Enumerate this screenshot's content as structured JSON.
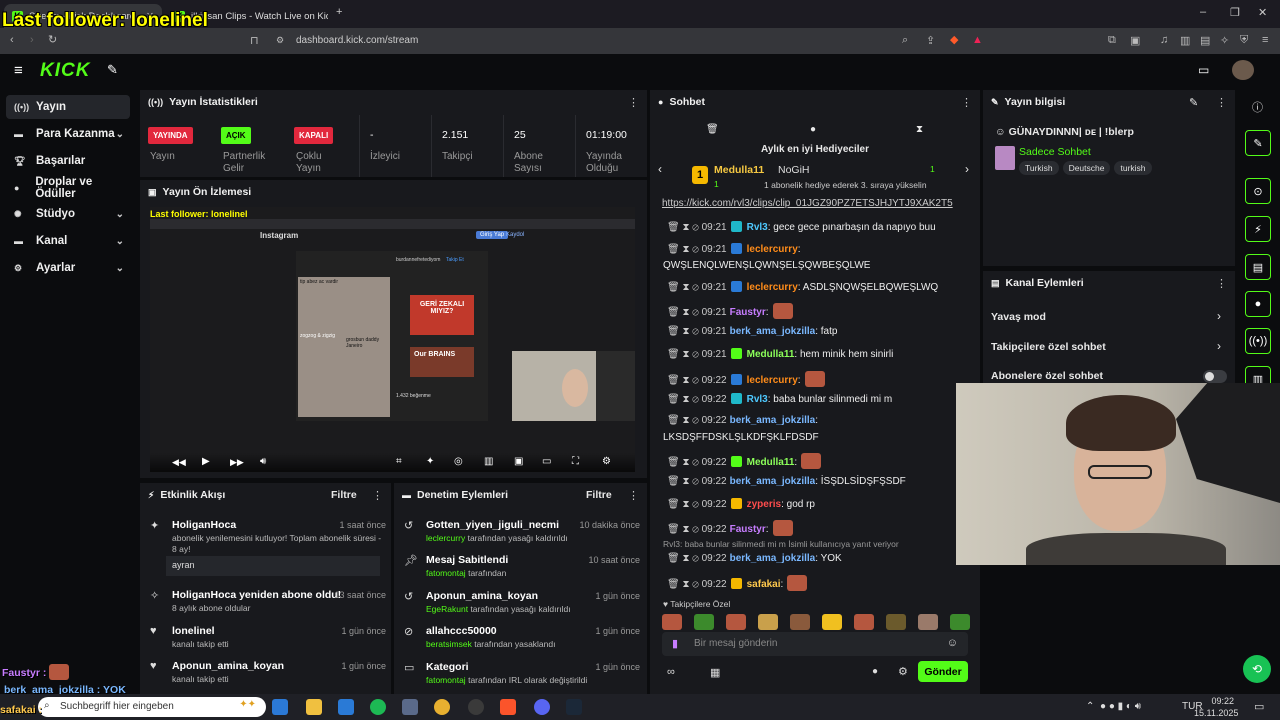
{
  "overlay": {
    "last_follower": "Last follower: lonelinel",
    "bottom_lines": [
      "Faustyr :",
      "berk_ama_jokzilla : YOK",
      "safakai :"
    ]
  },
  "browser": {
    "tabs": [
      "Stream - Kick Dashboard",
      "ilkinsan Clips - Watch Live on Kick"
    ],
    "url": "dashboard.kick.com/stream"
  },
  "sidebar": {
    "items": [
      "Yayın",
      "Para Kazanma",
      "Başarılar",
      "Droplar ve Ödüller",
      "Stüdyo",
      "Kanal",
      "Ayarlar"
    ]
  },
  "stats": {
    "title": "Yayın İstatistikleri",
    "badges": [
      "YAYINDA",
      "AÇIK",
      "KAPALI"
    ],
    "labels": [
      "Yayın",
      "Partnerlik Gelir",
      "Çoklu Yayın",
      "İzleyici",
      "Takipçi",
      "Abone Sayısı",
      "Yayında Olduğu"
    ],
    "values": [
      "-",
      "2.151",
      "25",
      "01:19:00"
    ]
  },
  "preview": {
    "title": "Yayın Ön İzlemesi",
    "inner_follower": "Last follower: lonelinel",
    "site": "Instagram",
    "signup": "Giriş Yap",
    "register": "Kaydol",
    "meme1": "tip abez ac vardir",
    "meme2": "zogzog & zigzig",
    "meme3": "grosbun daddy Janeiro",
    "meme4": "GERİ ZEKALI MIYIZ?",
    "meme5": "Our BRAINS",
    "user": "burdannefretediyom",
    "follow": "Takip Et",
    "likes": "1.432 beğenme"
  },
  "activity": {
    "title": "Etkinlik Akışı",
    "filter": "Filtre",
    "items": [
      {
        "name": "HoliganHoca",
        "time": "1 saat önce",
        "desc": "abonelik yenilemesini kutluyor! Toplam abonelik süresi - 8 ay!",
        "msg": "ayran"
      },
      {
        "name": "HoliganHoca yeniden abone oldu!",
        "time": "13 saat önce",
        "desc": "8 aylık abone oldular"
      },
      {
        "name": "lonelinel",
        "time": "1 gün önce",
        "desc": "kanalı takip etti"
      },
      {
        "name": "Aponun_amina_koyan",
        "time": "1 gün önce",
        "desc": "kanalı takip etti"
      }
    ]
  },
  "moderation": {
    "title": "Denetim Eylemleri",
    "filter": "Filtre",
    "items": [
      {
        "name": "Gotten_yiyen_jiguli_necmi",
        "time": "10 dakika önce",
        "by": "leclercurry",
        "desc": "tarafından yasağı kaldırıldı"
      },
      {
        "name": "Mesaj Sabitlendi",
        "time": "10 saat önce",
        "by": "fatomontaj",
        "desc": "tarafından"
      },
      {
        "name": "Aponun_amina_koyan",
        "time": "1 gün önce",
        "by": "EgeRakunt",
        "desc": "tarafından yasağı kaldırıldı"
      },
      {
        "name": "allahccc50000",
        "time": "1 gün önce",
        "by": "beratsimsek",
        "desc": "tarafından yasaklandı"
      },
      {
        "name": "Kategori",
        "time": "1 gün önce",
        "by": "fatomontaj",
        "desc": "tarafından IRL olarak değiştirildi"
      }
    ]
  },
  "chat": {
    "title": "Sohbet",
    "gifters_title": "Aylık en iyi Hediyeciler",
    "gifter1": "Medulla11",
    "gifter1_count": "1",
    "gifter2": "NoGiH",
    "gifter2_count": "1",
    "gifter_note": "1 abonelik hediye ederek 3. sıraya yükselin",
    "link": "https://kick.com/rvl3/clips/clip_01JGZ90PZ7ETSJHJYTJ9XAK2T5",
    "messages": [
      {
        "time": "09:21",
        "user": "Rvl3",
        "color": "#4ec9ff",
        "text": ": gece gece pınarbaşın da napıyo buu"
      },
      {
        "time": "09:21",
        "user": "leclercurry",
        "color": "#ff8c1a",
        "text": ":",
        "text2": "QWŞLENQLWENŞLQWNŞELŞQWBEŞQLWE"
      },
      {
        "time": "09:21",
        "user": "leclercurry",
        "color": "#ff8c1a",
        "text": ": ASDLŞNQWŞELBQWEŞLWQ"
      },
      {
        "time": "09:21",
        "user": "Faustyr",
        "color": "#c77dff",
        "text": ":"
      },
      {
        "time": "09:21",
        "user": "berk_ama_jokzilla",
        "color": "#7ab8ff",
        "text": ": fatp"
      },
      {
        "time": "09:21",
        "user": "Medulla11",
        "color": "#8cff5a",
        "text": ": hem minik hem sinirli"
      },
      {
        "time": "09:22",
        "user": "leclercurry",
        "color": "#ff8c1a",
        "text": ":"
      },
      {
        "time": "09:22",
        "user": "Rvl3",
        "color": "#4ec9ff",
        "text": ": baba bunlar silinmedi mi m"
      },
      {
        "time": "09:22",
        "user": "berk_ama_jokzilla",
        "color": "#7ab8ff",
        "text": ":",
        "text2": "LKSDŞFFDSKLŞLKDFŞKLFDSDF"
      },
      {
        "time": "09:22",
        "user": "Medulla11",
        "color": "#8cff5a",
        "text": ":"
      },
      {
        "time": "09:22",
        "user": "berk_ama_jokzilla",
        "color": "#7ab8ff",
        "text": ": İSŞDLSİDŞFŞSDF"
      },
      {
        "time": "09:22",
        "user": "zyperis",
        "color": "#ff4d4d",
        "text": ": god rp"
      },
      {
        "time": "09:22",
        "user": "Faustyr",
        "color": "#c77dff",
        "text": ":"
      },
      {
        "time": "09:22",
        "user": "berk_ama_jokzilla",
        "color": "#7ab8ff",
        "text": ": YOK"
      },
      {
        "time": "09:22",
        "user": "safakai",
        "color": "#ffc94d",
        "text": ":"
      }
    ],
    "reply_note": "Rvl3: baba bunlar silinmedi mi m İsimli kullanıcıya yanıt veriyor",
    "followers_only": "Takipçilere Özel",
    "placeholder": "Bir mesaj gönderin",
    "send": "Gönder"
  },
  "stream_info": {
    "title": "Yayın bilgisi",
    "stream_title": "GÜNAYDINNN| ᴅᴇ | !blerp",
    "category": "Sadece Sohbet",
    "tags": [
      "Turkish",
      "Deutsche",
      "turkish"
    ]
  },
  "channel_actions": {
    "title": "Kanal Eylemleri",
    "items": [
      "Yavaş mod",
      "Takipçilere özel sohbet",
      "Abonelere özel sohbet"
    ]
  },
  "taskbar": {
    "search": "Suchbegriff hier eingeben",
    "lang": "TUR",
    "time": "09:22",
    "date": "15.11.2025"
  }
}
